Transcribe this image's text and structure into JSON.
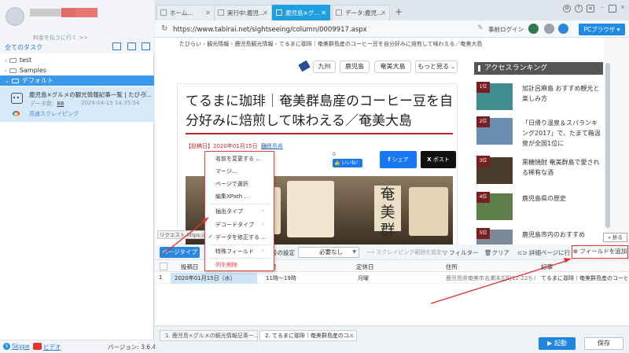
{
  "sidebar": {
    "pay_link": "料金を払うに行く >>",
    "tasks_title": "全てのタスク",
    "tree": [
      {
        "label": "test"
      },
      {
        "label": "Samples"
      },
      {
        "label": "デフォルト"
      }
    ],
    "task": {
      "name": "鹿児島×グルメの観光情報記事一覧 | たびら...",
      "count_label": "データ数:",
      "count": "88",
      "date": "2024-04-15 14:35:54",
      "speed": "高速スクレイピング"
    },
    "footer": {
      "skype": "Skype",
      "video": "ビデオ",
      "version": "バージョン: 3.6.4"
    }
  },
  "browser": {
    "tabs": [
      {
        "label": "ホーム..."
      },
      {
        "label": "実行中:鹿児..."
      },
      {
        "label": "鹿児島×グ..."
      },
      {
        "label": "データ:鹿児..."
      }
    ],
    "url": "https://www.tabirai.net/sightseeing/column/0009917.aspx",
    "goto_login": "事前ログイン",
    "pc_browser": "PCブラウザ"
  },
  "webpage": {
    "breadcrumb": {
      "a": "たびらい",
      "b": "観光情報",
      "c": "鹿児島観光情報",
      "d": "てるまに珈琲｜奄美群島産のコーヒー豆を自分好みに焙煎して味わえる／奄美大島"
    },
    "chips": [
      "九州",
      "鹿児島",
      "奄美大島",
      "もっと見る"
    ],
    "title": "てるまに珈琲｜奄美群島産のコーヒー豆を自分好みに焙煎して味わえる／奄美大島",
    "meta_prefix": "【投稿日】2020年01月15日（水）",
    "meta_region": "鹿児島県",
    "like_count": "0",
    "like": "いいね！",
    "share": "シェア",
    "post": "ポスト",
    "photo_text": "奄美群",
    "status_url": "リクエスト https://...",
    "ranking": {
      "header": "アクセスランキング",
      "items": [
        {
          "rank": "1位",
          "text": "加計呂麻島 おすすめ観光と楽しみ方"
        },
        {
          "rank": "2位",
          "text": "「日帰り温泉＆スパランキング2017」で、たまて箱温泉が全国1位に"
        },
        {
          "rank": "3位",
          "text": "黒糖焼酎 奄美群島で愛される稀有な酒"
        },
        {
          "rank": "4位",
          "text": "鹿児島県の歴史"
        },
        {
          "rank": "5位",
          "text": "鹿児島市内のおすすめ"
        }
      ]
    },
    "collapse": "折る"
  },
  "panel": {
    "page_type": "ページタイプ",
    "field_setting": "号の設定",
    "needs": "必要なし",
    "scrape_range": "スクレイピング範囲を設定",
    "filter": "フィルター",
    "clear": "クリア",
    "detail": "詳細ページに行く",
    "add_field": "フィールドを追加",
    "columns": [
      "投稿日",
      "時間",
      "定休日",
      "住所",
      "記事"
    ],
    "rows": [
      [
        "1",
        "2020年01月15日（水）",
        "11時～19時",
        "月曜",
        "鹿児島県奄美市名瀬末広町12-22もと...",
        "てるまに珈琲｜奄美群島産のコーヒ..."
      ]
    ]
  },
  "context_menu": [
    "名前を変更する ...",
    "マージ...",
    "ページで選択",
    "編集XPath ...",
    "抽出タイプ",
    "デコードタイプ",
    "データを修正する ...",
    "特殊フィールド",
    "列を削除"
  ],
  "bottom": {
    "tab1": "1. 鹿児島×グルメの観光情報記事一...",
    "tab2": "2. てるまに珈琲｜奄美群島産のコ...",
    "run": "起動",
    "save": "保存"
  },
  "colors": {
    "accent": "#1f86e0",
    "highlight": "#e4302b",
    "selected": "#3a98ea"
  }
}
